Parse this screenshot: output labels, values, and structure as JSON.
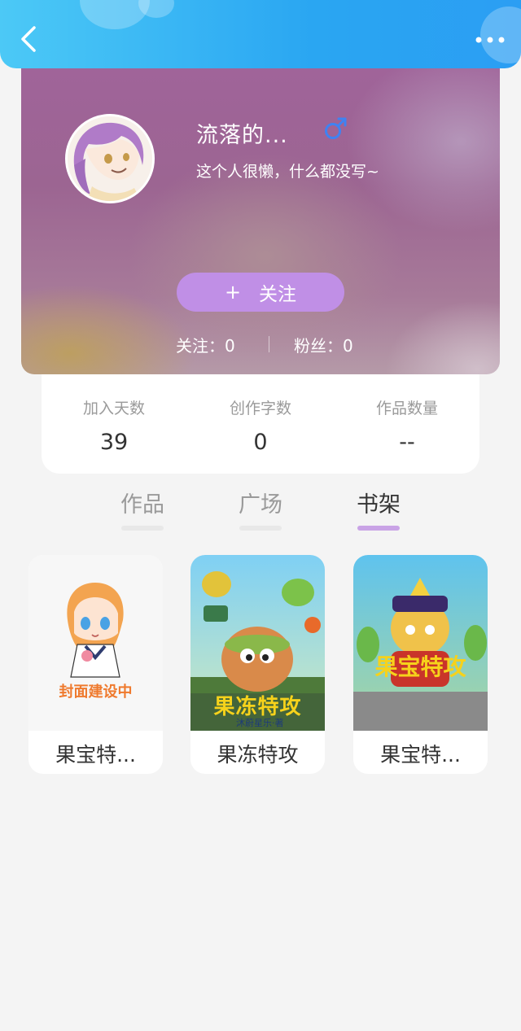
{
  "header": {
    "back_icon": "chevron-left-icon",
    "more_icon": "more-horizontal-icon",
    "color_start": "#4cc9f6",
    "color_end": "#2b9ef3"
  },
  "profile": {
    "username": "流落的...",
    "gender_icon": "male-icon",
    "bio": "这个人很懒，什么都没写~",
    "follow_button": {
      "plus": "+",
      "label": "关注"
    },
    "following": "关注：0",
    "fans": "粉丝：0",
    "accent": "#c08fe6"
  },
  "stats": [
    {
      "label": "加入天数",
      "value": "39"
    },
    {
      "label": "创作字数",
      "value": "0"
    },
    {
      "label": "作品数量",
      "value": "--"
    }
  ],
  "tabs": [
    {
      "label": "作品",
      "active": false
    },
    {
      "label": "广场",
      "active": false
    },
    {
      "label": "书架",
      "active": true
    }
  ],
  "books": [
    {
      "title": "果宝特...",
      "cover_caption": "封面建设中"
    },
    {
      "title": "果冻特攻",
      "cover_logo": "果冻特攻",
      "cover_sub": "沐蔚星乐·著"
    },
    {
      "title": "果宝特...",
      "cover_logo": "果宝特攻"
    }
  ]
}
